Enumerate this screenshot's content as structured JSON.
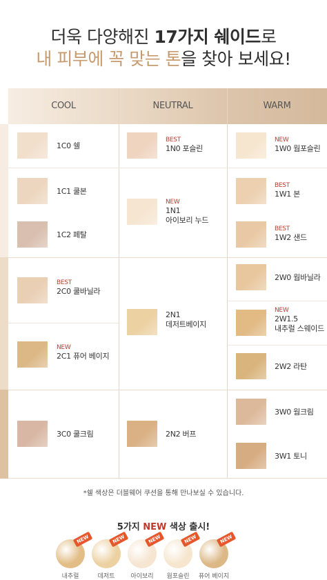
{
  "title": {
    "line1_pre": "더욱 다양해진 ",
    "line1_bold": "17가지 쉐이드",
    "line1_post": "로",
    "line2_main": "내 피부에 꼭 맞는 톤",
    "line2_end": "을 찾아 보세요!"
  },
  "headers": [
    "COOL",
    "NEUTRAL",
    "WARM"
  ],
  "cool": [
    {
      "badge": "",
      "name": "1C0 쉘",
      "color": "#f1dfcc"
    },
    {
      "badge": "",
      "name": "1C1 쿨본",
      "color": "#ecd6bf"
    },
    {
      "badge": "",
      "name": "1C2 페탈",
      "color": "#d9bfaf"
    },
    {
      "badge": "BEST",
      "name": "2C0 쿨바닐라",
      "color": "#e9cfb4"
    },
    {
      "badge": "NEW",
      "name": "2C1 퓨어 베이지",
      "color": "#dcb887"
    },
    {
      "badge": "",
      "name": "3C0 쿨크림",
      "color": "#d8b8a4"
    }
  ],
  "neutral": [
    {
      "badge": "BEST",
      "name": "1N0 포슬린",
      "color": "#efd4c0"
    },
    {
      "badge": "NEW",
      "name": "1N1",
      "name2": "아이보리 누드",
      "color": "#f6e5d1"
    },
    {
      "badge": "",
      "name": "2N1",
      "name2": "데저트베이지",
      "color": "#ecd1a2"
    },
    {
      "badge": "",
      "name": "2N2 버프",
      "color": "#d9b185"
    }
  ],
  "warm": [
    {
      "badge": "NEW",
      "name": "1W0 웜포슬린",
      "color": "#f6e6cf"
    },
    {
      "badge": "BEST",
      "name": "1W1 본",
      "color": "#ecd0b0"
    },
    {
      "badge": "BEST",
      "name": "1W2 샌드",
      "color": "#e9c9a5"
    },
    {
      "badge": "",
      "name": "2W0 웜바닐라",
      "color": "#e8c79e"
    },
    {
      "badge": "NEW",
      "name": "2W1.5",
      "name2": "내추럴 스웨이드",
      "color": "#e1ba84"
    },
    {
      "badge": "",
      "name": "2W2 라탄",
      "color": "#d9b47c"
    },
    {
      "badge": "",
      "name": "3W0 웜크림",
      "color": "#ddb99b"
    },
    {
      "badge": "",
      "name": "3W1 토니",
      "color": "#d6ac82"
    }
  ],
  "note": "*쉘 색상은 더블웨어 쿠션을 통해 만나보실 수 있습니다.",
  "new_section": {
    "title_pre": "5가지 ",
    "title_accent": "NEW",
    "title_post": " 색상 출시!",
    "tag": "NEW",
    "items": [
      {
        "label": "내추럴",
        "color": "#e2bd86"
      },
      {
        "label": "데저트",
        "color": "#ecd1a2"
      },
      {
        "label": "아이보리",
        "color": "#f6e5d1"
      },
      {
        "label": "웜포슬린",
        "color": "#f6e6cf"
      },
      {
        "label": "퓨어 베이지",
        "color": "#dcb887"
      }
    ]
  }
}
